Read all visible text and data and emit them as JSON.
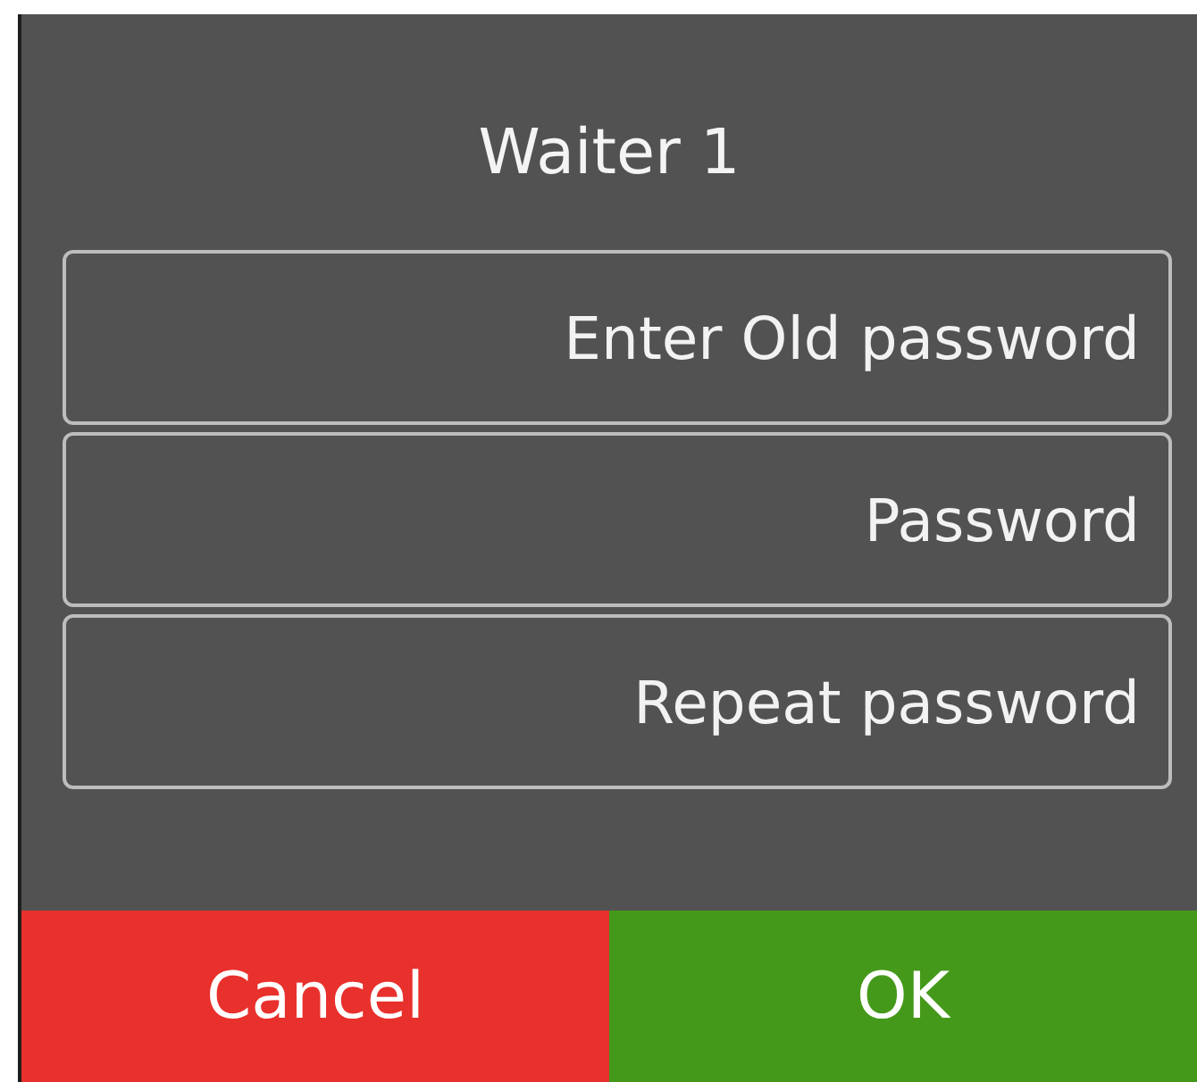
{
  "dialog": {
    "title": "Waiter 1"
  },
  "fields": [
    {
      "placeholder": "Enter Old password"
    },
    {
      "placeholder": "Password"
    },
    {
      "placeholder": "Repeat password"
    }
  ],
  "buttons": [
    {
      "label": "Cancel",
      "kind": "cancel"
    },
    {
      "label": "OK",
      "kind": "confirm"
    }
  ]
}
